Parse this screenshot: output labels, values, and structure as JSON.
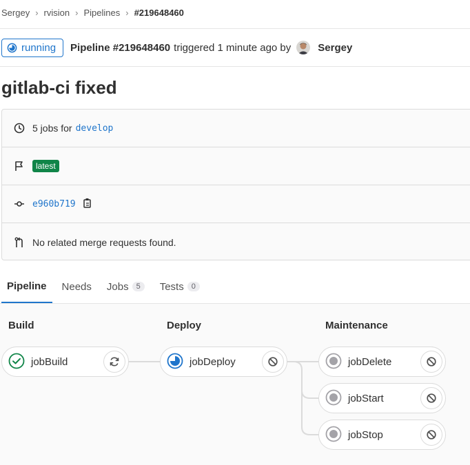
{
  "breadcrumb": [
    "Sergey",
    "rvision",
    "Pipelines",
    "#219648460"
  ],
  "header": {
    "status": "running",
    "pipeline_id": "Pipeline #219648460",
    "triggered_text": "triggered 1 minute ago by",
    "user": "Sergey"
  },
  "title": "gitlab-ci fixed",
  "info": {
    "jobs_prefix": "5 jobs for",
    "branch": "develop",
    "tag": "latest",
    "commit_sha": "e960b719",
    "merge_requests": "No related merge requests found."
  },
  "tabs": [
    {
      "label": "Pipeline",
      "count": null
    },
    {
      "label": "Needs",
      "count": null
    },
    {
      "label": "Jobs",
      "count": "5"
    },
    {
      "label": "Tests",
      "count": "0"
    }
  ],
  "stages": [
    {
      "name": "Build",
      "jobs": [
        {
          "name": "jobBuild",
          "status": "success",
          "action": "retry"
        }
      ]
    },
    {
      "name": "Deploy",
      "jobs": [
        {
          "name": "jobDeploy",
          "status": "running",
          "action": "cancel"
        }
      ]
    },
    {
      "name": "Maintenance",
      "jobs": [
        {
          "name": "jobDelete",
          "status": "created",
          "action": "cancel"
        },
        {
          "name": "jobStart",
          "status": "created",
          "action": "cancel"
        },
        {
          "name": "jobStop",
          "status": "created",
          "action": "cancel"
        }
      ]
    }
  ],
  "colors": {
    "running": "#1f75cb",
    "success": "#108548",
    "created": "#a4a3a8",
    "tag": "#108548"
  }
}
